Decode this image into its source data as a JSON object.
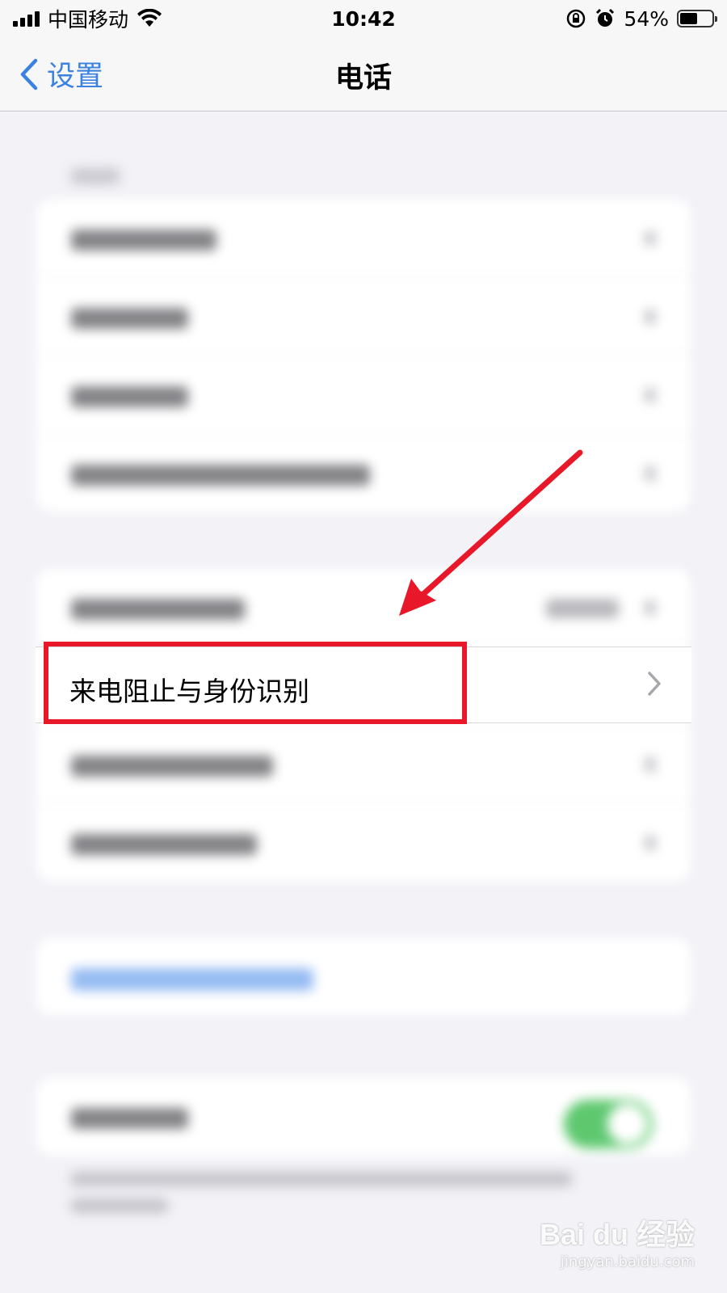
{
  "status_bar": {
    "carrier": "中国移动",
    "time": "10:42",
    "battery": "54%",
    "battery_level": 0.54,
    "icons": [
      "signal-icon",
      "wifi-icon",
      "orientation-lock-icon",
      "alarm-icon",
      "battery-icon"
    ]
  },
  "nav": {
    "back_label": "设置",
    "title": "电话"
  },
  "focused_row": {
    "label": "来电阻止与身份识别"
  },
  "colors": {
    "accent": "#3b82e0",
    "annotation_red": "#e8182a",
    "toggle_green": "#5ec86f",
    "background": "#f2f2f7"
  },
  "watermark": {
    "brand": "Bai du 经验",
    "url": "jingyan.baidu.com"
  }
}
